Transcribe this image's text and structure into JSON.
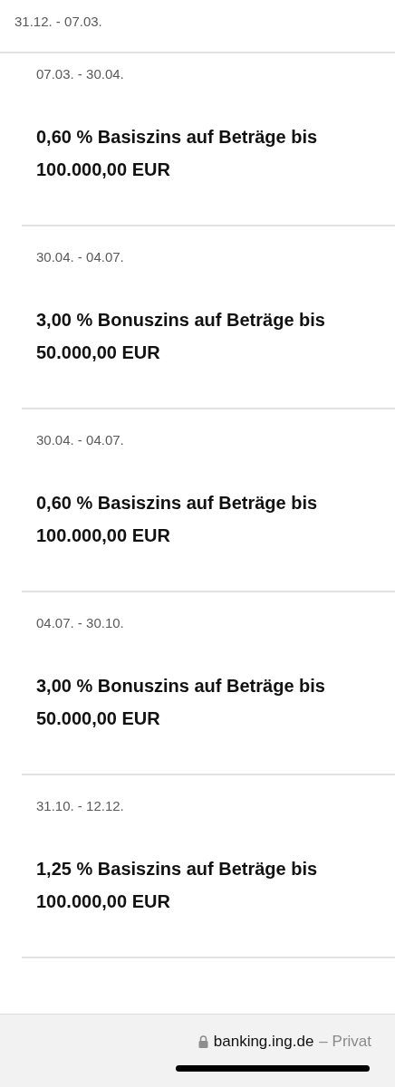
{
  "header": {
    "date_range": "31.12. - 07.03."
  },
  "periods": [
    {
      "date_range": "07.03. - 30.04.",
      "rate": "0,60 % Basiszins auf Beträge bis 100.000,00 EUR"
    },
    {
      "date_range": "30.04. - 04.07.",
      "rate": "3,00 % Bonuszins auf Beträge bis 50.000,00 EUR"
    },
    {
      "date_range": "30.04. - 04.07.",
      "rate": "0,60 % Basiszins auf Beträge bis 100.000,00 EUR"
    },
    {
      "date_range": "04.07. - 30.10.",
      "rate": "3,00 % Bonuszins auf Beträge bis 50.000,00 EUR"
    },
    {
      "date_range": "31.10. - 12.12.",
      "rate": "1,25 % Basiszins auf Beträge bis 100.000,00 EUR"
    }
  ],
  "browser_bar": {
    "domain": "banking.ing.de",
    "mode": "– Privat"
  }
}
